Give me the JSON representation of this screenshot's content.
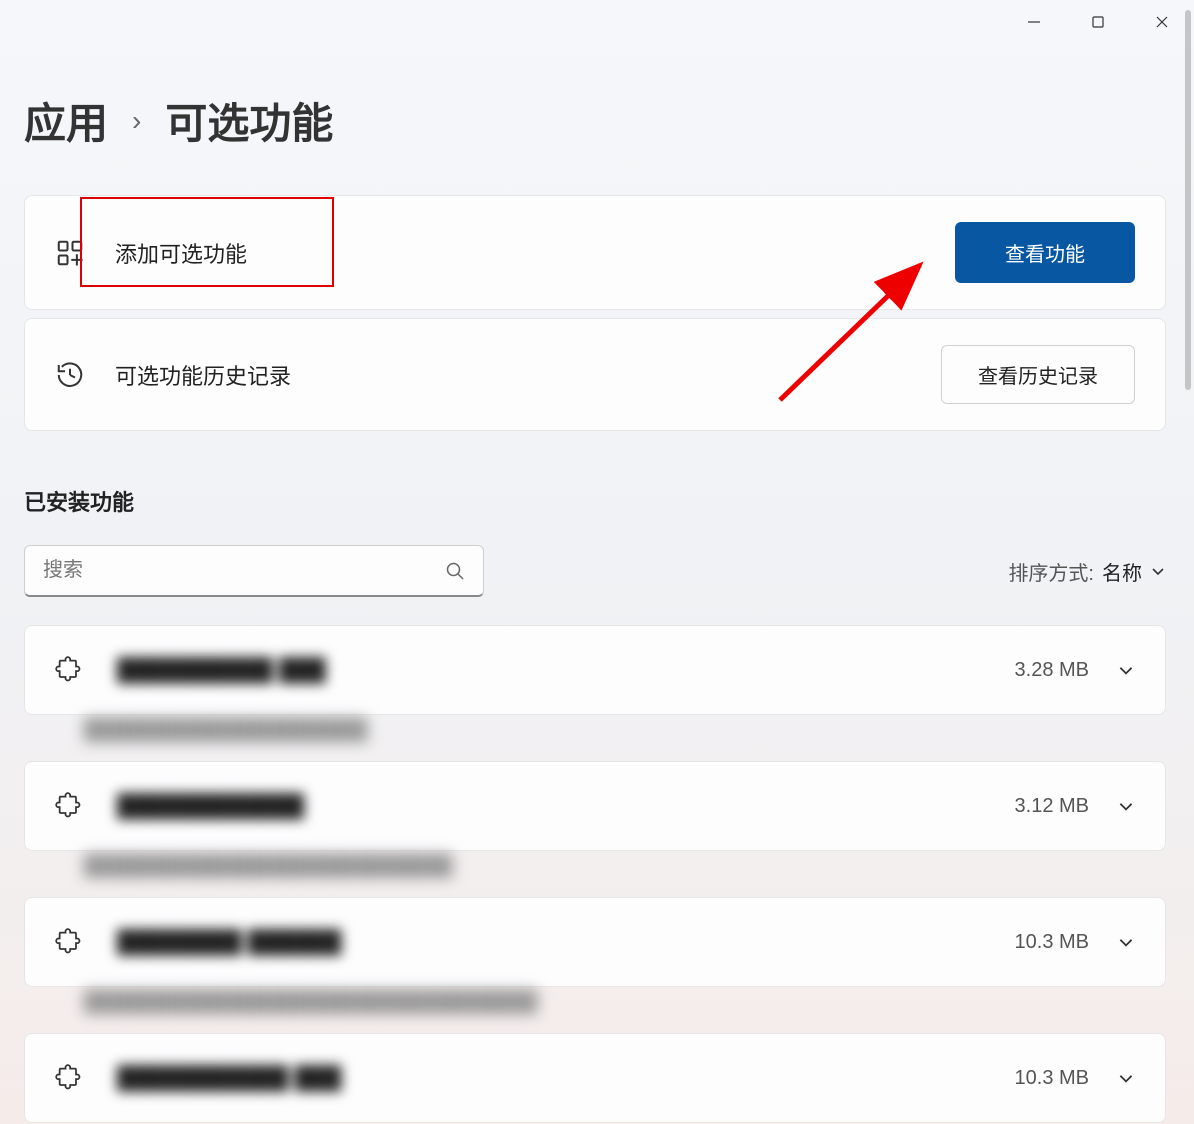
{
  "breadcrumb": {
    "app": "应用",
    "separator": "›",
    "current": "可选功能"
  },
  "cards": {
    "add": {
      "title": "添加可选功能",
      "button": "查看功能"
    },
    "history": {
      "title": "可选功能历史记录",
      "button": "查看历史记录"
    }
  },
  "section": {
    "installed_title": "已安装功能"
  },
  "search": {
    "placeholder": "搜索"
  },
  "sort": {
    "label": "排序方式:",
    "value": "名称"
  },
  "features": [
    {
      "name": "██████████ ███",
      "size": "3.28 MB",
      "desc": "████████████████████"
    },
    {
      "name": "████████████",
      "size": "3.12 MB",
      "desc": "██████████████████████████"
    },
    {
      "name": "████████ ██████",
      "size": "10.3 MB",
      "desc": "████████████████████████████████"
    },
    {
      "name": "███████████ ███",
      "size": "10.3 MB",
      "desc": ""
    }
  ]
}
